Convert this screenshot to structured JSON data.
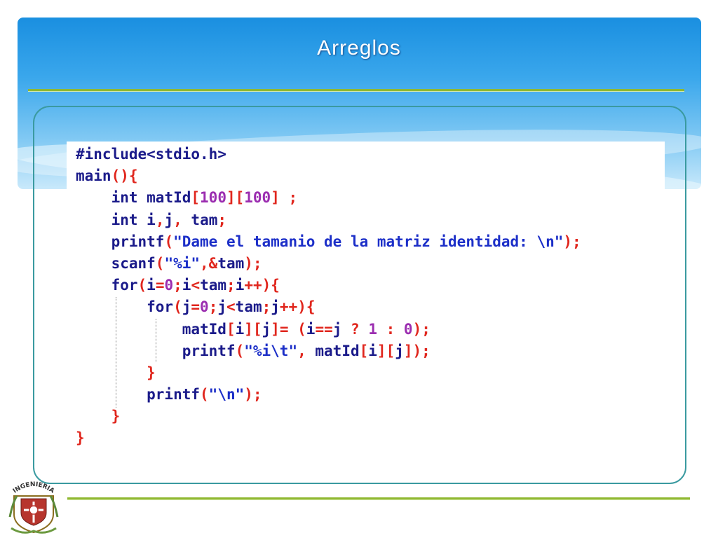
{
  "slide": {
    "title": "Arreglos"
  },
  "colors": {
    "header_blue": "#1a8fe0",
    "rule_green": "#8fb832",
    "frame_teal": "#3a9aa0",
    "code_keyword": "#1b1b8a",
    "code_punct": "#e0261d",
    "code_string": "#1c2fc8",
    "code_number": "#9b2db0"
  },
  "code": {
    "language": "C",
    "lines": [
      [
        {
          "t": "#include<stdio.h>",
          "c": "kw"
        }
      ],
      [
        {
          "t": "main",
          "c": "kw"
        },
        {
          "t": "(){",
          "c": "pn"
        }
      ],
      [
        {
          "t": "    int ",
          "c": "kw"
        },
        {
          "t": "matId",
          "c": "kw"
        },
        {
          "t": "[",
          "c": "pn"
        },
        {
          "t": "100",
          "c": "nm"
        },
        {
          "t": "][",
          "c": "pn"
        },
        {
          "t": "100",
          "c": "nm"
        },
        {
          "t": "] ;",
          "c": "pn"
        }
      ],
      [
        {
          "t": "    int ",
          "c": "kw"
        },
        {
          "t": "i",
          "c": "kw"
        },
        {
          "t": ",",
          "c": "pn"
        },
        {
          "t": "j",
          "c": "kw"
        },
        {
          "t": ", ",
          "c": "pn"
        },
        {
          "t": "tam",
          "c": "kw"
        },
        {
          "t": ";",
          "c": "pn"
        }
      ],
      [
        {
          "t": "    printf",
          "c": "kw"
        },
        {
          "t": "(",
          "c": "pn"
        },
        {
          "t": "\"Dame el tamanio de la matriz identidad: \\n\"",
          "c": "st"
        },
        {
          "t": ");",
          "c": "pn"
        }
      ],
      [
        {
          "t": "    scanf",
          "c": "kw"
        },
        {
          "t": "(",
          "c": "pn"
        },
        {
          "t": "\"%i\"",
          "c": "st"
        },
        {
          "t": ",&",
          "c": "pn"
        },
        {
          "t": "tam",
          "c": "kw"
        },
        {
          "t": ");",
          "c": "pn"
        }
      ],
      [
        {
          "t": "    for",
          "c": "kw"
        },
        {
          "t": "(",
          "c": "pn"
        },
        {
          "t": "i",
          "c": "kw"
        },
        {
          "t": "=",
          "c": "pn"
        },
        {
          "t": "0",
          "c": "nm"
        },
        {
          "t": ";",
          "c": "pn"
        },
        {
          "t": "i",
          "c": "kw"
        },
        {
          "t": "<",
          "c": "pn"
        },
        {
          "t": "tam",
          "c": "kw"
        },
        {
          "t": ";",
          "c": "pn"
        },
        {
          "t": "i",
          "c": "kw"
        },
        {
          "t": "++){",
          "c": "pn"
        }
      ],
      [
        {
          "t": "        for",
          "c": "kw"
        },
        {
          "t": "(",
          "c": "pn"
        },
        {
          "t": "j",
          "c": "kw"
        },
        {
          "t": "=",
          "c": "pn"
        },
        {
          "t": "0",
          "c": "nm"
        },
        {
          "t": ";",
          "c": "pn"
        },
        {
          "t": "j",
          "c": "kw"
        },
        {
          "t": "<",
          "c": "pn"
        },
        {
          "t": "tam",
          "c": "kw"
        },
        {
          "t": ";",
          "c": "pn"
        },
        {
          "t": "j",
          "c": "kw"
        },
        {
          "t": "++){",
          "c": "pn"
        }
      ],
      [
        {
          "t": "            matId",
          "c": "kw"
        },
        {
          "t": "[",
          "c": "pn"
        },
        {
          "t": "i",
          "c": "kw"
        },
        {
          "t": "][",
          "c": "pn"
        },
        {
          "t": "j",
          "c": "kw"
        },
        {
          "t": "]= (",
          "c": "pn"
        },
        {
          "t": "i",
          "c": "kw"
        },
        {
          "t": "==",
          "c": "pn"
        },
        {
          "t": "j ",
          "c": "kw"
        },
        {
          "t": "? ",
          "c": "pn"
        },
        {
          "t": "1",
          "c": "nm"
        },
        {
          "t": " : ",
          "c": "pn"
        },
        {
          "t": "0",
          "c": "nm"
        },
        {
          "t": ");",
          "c": "pn"
        }
      ],
      [
        {
          "t": "            printf",
          "c": "kw"
        },
        {
          "t": "(",
          "c": "pn"
        },
        {
          "t": "\"%i\\t\"",
          "c": "st"
        },
        {
          "t": ", ",
          "c": "pn"
        },
        {
          "t": "matId",
          "c": "kw"
        },
        {
          "t": "[",
          "c": "pn"
        },
        {
          "t": "i",
          "c": "kw"
        },
        {
          "t": "][",
          "c": "pn"
        },
        {
          "t": "j",
          "c": "kw"
        },
        {
          "t": "]);",
          "c": "pn"
        }
      ],
      [
        {
          "t": "        }",
          "c": "pn"
        }
      ],
      [
        {
          "t": "        printf",
          "c": "kw"
        },
        {
          "t": "(",
          "c": "pn"
        },
        {
          "t": "\"\\n\"",
          "c": "st"
        },
        {
          "t": ");",
          "c": "pn"
        }
      ],
      [
        {
          "t": "    }",
          "c": "pn"
        }
      ],
      [
        {
          "t": "}",
          "c": "pn"
        }
      ]
    ]
  },
  "logo": {
    "text": "INGENIERIA",
    "icon": "faculty-crest-icon"
  }
}
